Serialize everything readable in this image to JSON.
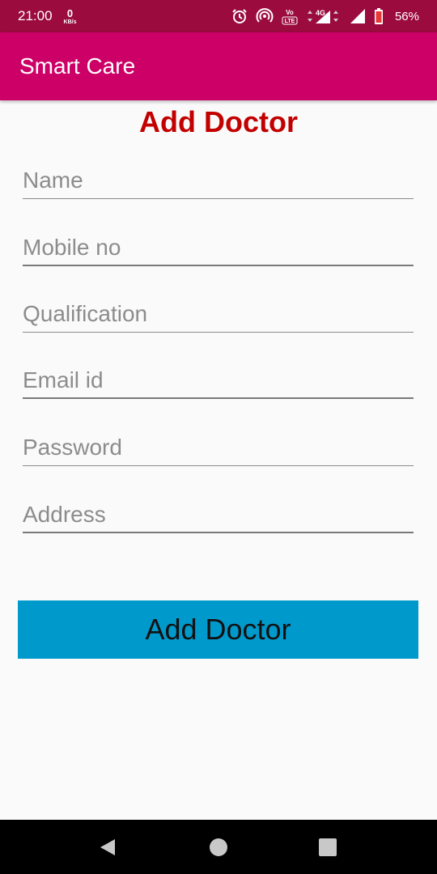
{
  "status_bar": {
    "time": "21:00",
    "speed_value": "0",
    "speed_unit": "KB/s",
    "volte_label": "Vo LTE",
    "network_label": "4G",
    "battery": "56%",
    "icons": [
      "alarm-icon",
      "hotspot-icon",
      "volte-icon",
      "network-4g-icon",
      "signal-icon",
      "battery-icon"
    ]
  },
  "app_bar": {
    "title": "Smart Care"
  },
  "form": {
    "heading": "Add Doctor",
    "fields": [
      {
        "placeholder": "Name",
        "value": ""
      },
      {
        "placeholder": "Mobile no",
        "value": ""
      },
      {
        "placeholder": "Qualification",
        "value": ""
      },
      {
        "placeholder": "Email id",
        "value": ""
      },
      {
        "placeholder": "Password",
        "value": ""
      },
      {
        "placeholder": "Address",
        "value": ""
      }
    ],
    "submit_label": "Add Doctor"
  },
  "nav_bar": {
    "icons": [
      "back-icon",
      "home-icon",
      "recents-icon"
    ]
  },
  "colors": {
    "status_bar": "#9b0b3e",
    "app_bar": "#cc0066",
    "heading": "#c20000",
    "button": "#0099cc",
    "background": "#fafafa"
  }
}
